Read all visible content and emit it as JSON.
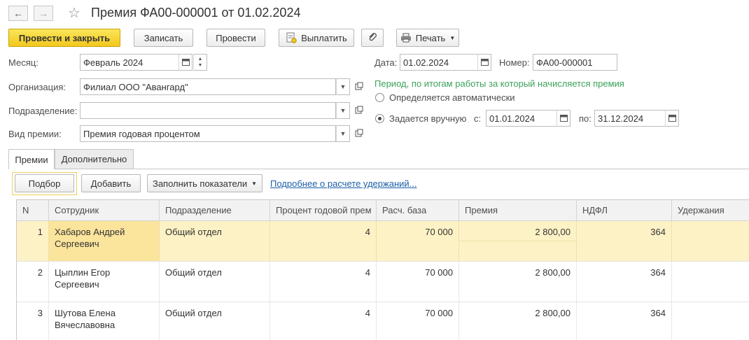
{
  "window": {
    "title": "Премия ФА00-000001 от 01.02.2024"
  },
  "toolbar": {
    "post_close": "Провести и закрыть",
    "write": "Записать",
    "post": "Провести",
    "pay": "Выплатить",
    "print": "Печать"
  },
  "form": {
    "month_label": "Месяц:",
    "month_value": "Февраль 2024",
    "org_label": "Организация:",
    "org_value": "Филиал ООО \"Авангард\"",
    "dept_label": "Подразделение:",
    "dept_value": "",
    "bonus_type_label": "Вид премии:",
    "bonus_type_value": "Премия годовая процентом",
    "date_label": "Дата:",
    "date_value": "01.02.2024",
    "number_label": "Номер:",
    "number_value": "ФА00-000001",
    "period_hint": "Период, по итогам работы за который начисляется премия",
    "radio_auto": "Определяется автоматически",
    "radio_manual": "Задается вручную",
    "from_label": "с:",
    "from_value": "01.01.2024",
    "to_label": "по:",
    "to_value": "31.12.2024"
  },
  "tabs": [
    {
      "label": "Премии",
      "active": true
    },
    {
      "label": "Дополнительно",
      "active": false
    }
  ],
  "table_toolbar": {
    "pick": "Подбор",
    "add": "Добавить",
    "fill": "Заполнить показатели",
    "details_link": "Подробнее о расчете удержаний..."
  },
  "table": {
    "columns": [
      "N",
      "Сотрудник",
      "Подразделение",
      "Процент годовой прем",
      "Расч. база",
      "Премия",
      "НДФЛ",
      "Удержания"
    ],
    "rows": [
      {
        "n": "1",
        "employee": "Хабаров Андрей Сергеевич",
        "dept": "Общий отдел",
        "percent": "4",
        "base": "70 000",
        "bonus": "2 800,00",
        "ndfl": "364",
        "deductions": "",
        "selected": true
      },
      {
        "n": "2",
        "employee": "Цыплин Егор Сергеевич",
        "dept": "Общий отдел",
        "percent": "4",
        "base": "70 000",
        "bonus": "2 800,00",
        "ndfl": "364",
        "deductions": "",
        "selected": false
      },
      {
        "n": "3",
        "employee": "Шутова Елена Вячеславовна",
        "dept": "Общий отдел",
        "percent": "4",
        "base": "70 000",
        "bonus": "2 800,00",
        "ndfl": "364",
        "deductions": "",
        "selected": false
      }
    ]
  },
  "colors": {
    "primary_button": "#f2c81d",
    "selected_row": "#fdf2c5",
    "current_cell": "#fbe49b",
    "hint_green": "#3aa25a",
    "link": "#1c5fa8"
  }
}
